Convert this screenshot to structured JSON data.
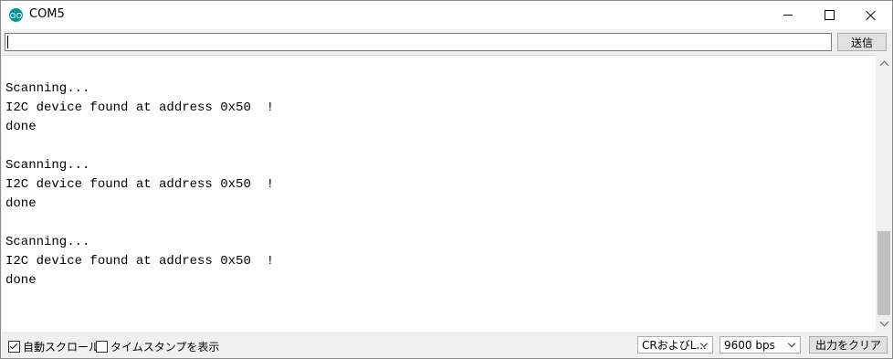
{
  "window": {
    "title": "COM5"
  },
  "send": {
    "input_value": "",
    "button_label": "送信"
  },
  "output": {
    "lines": [
      "done",
      "",
      "Scanning...",
      "I2C device found at address 0x50  !",
      "done",
      "",
      "Scanning...",
      "I2C device found at address 0x50  !",
      "done",
      "",
      "Scanning...",
      "I2C device found at address 0x50  !",
      "done"
    ]
  },
  "statusbar": {
    "autoscroll_label": "自動スクロール",
    "autoscroll_checked": true,
    "timestamp_label": "タイムスタンプを表示",
    "timestamp_checked": false,
    "line_ending_value": "CRおよびL...",
    "baud_value": "9600 bps",
    "clear_label": "出力をクリア"
  },
  "icons": {
    "app": "arduino-logo-icon",
    "minimize": "minimize-icon",
    "maximize": "maximize-icon",
    "close": "close-icon"
  }
}
